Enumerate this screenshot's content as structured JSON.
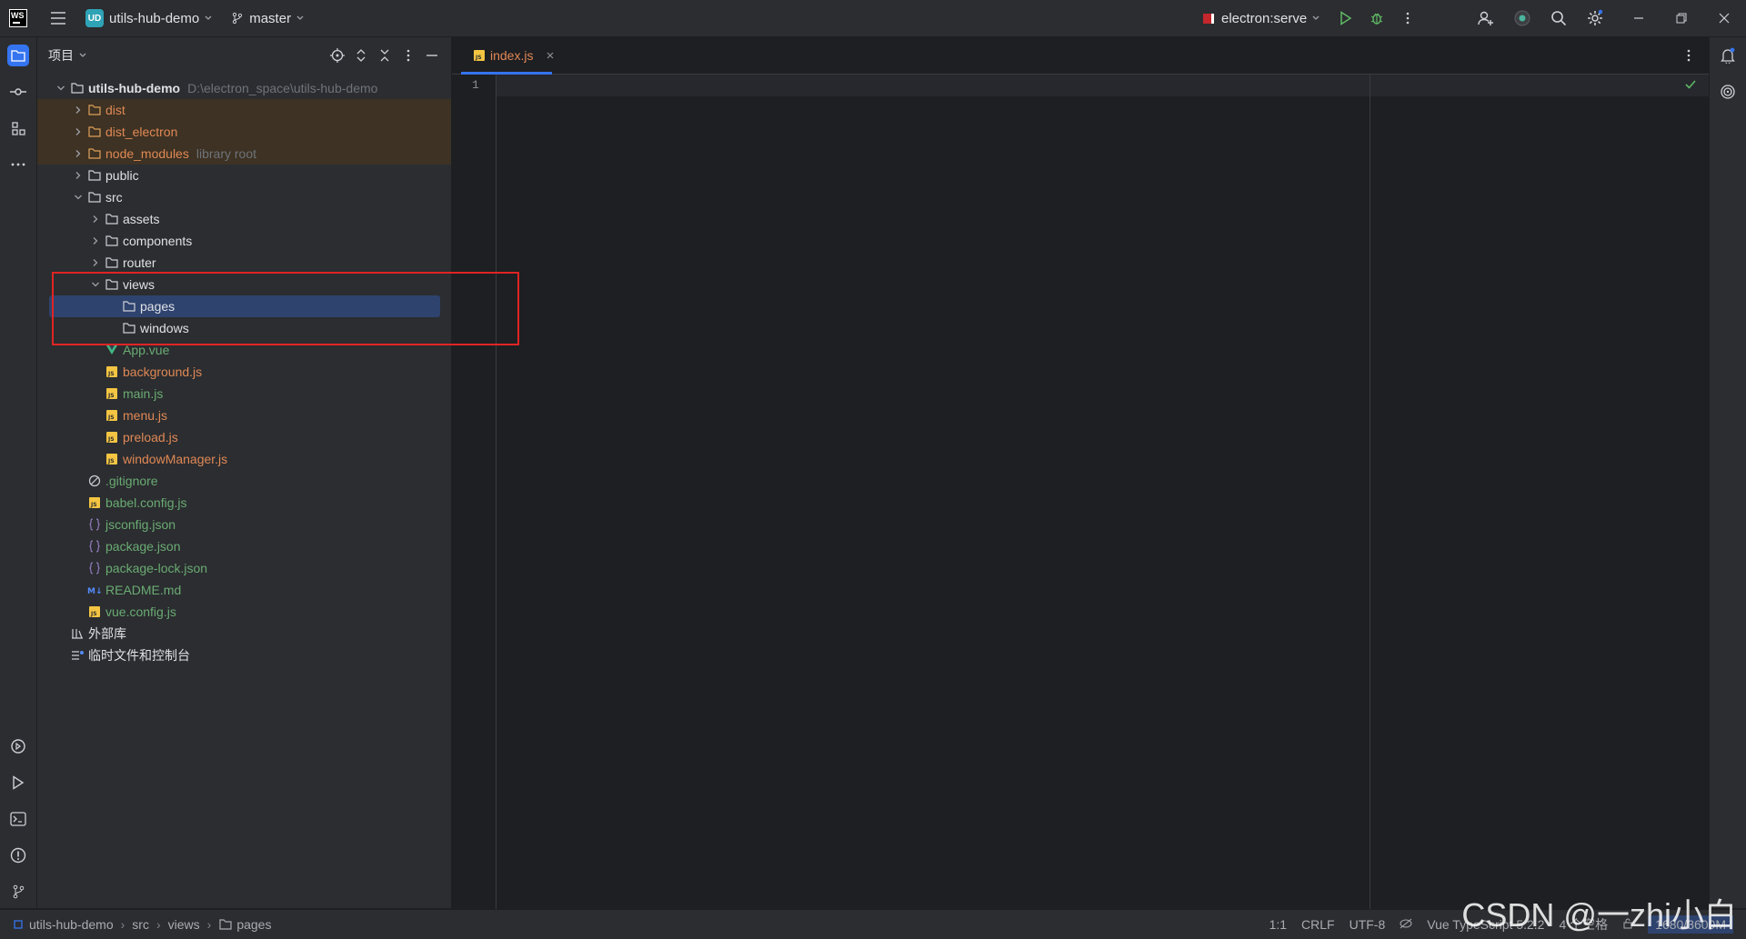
{
  "titlebar": {
    "project_badge": "UD",
    "project_name": "utils-hub-demo",
    "branch": "master",
    "run_config": "electron:serve"
  },
  "project_panel": {
    "title": "项目",
    "tree": [
      {
        "label": "utils-hub-demo",
        "hint": "D:\\electron_space\\utils-hub-demo",
        "depth": 0,
        "expanded": true,
        "kind": "folder-root"
      },
      {
        "label": "dist",
        "hint": "",
        "depth": 1,
        "expanded": false,
        "kind": "folder-excluded"
      },
      {
        "label": "dist_electron",
        "hint": "",
        "depth": 1,
        "expanded": false,
        "kind": "folder-excluded"
      },
      {
        "label": "node_modules",
        "hint": "library root",
        "depth": 1,
        "expanded": false,
        "kind": "folder-excluded"
      },
      {
        "label": "public",
        "hint": "",
        "depth": 1,
        "expanded": false,
        "kind": "folder"
      },
      {
        "label": "src",
        "hint": "",
        "depth": 1,
        "expanded": true,
        "kind": "folder"
      },
      {
        "label": "assets",
        "hint": "",
        "depth": 2,
        "expanded": false,
        "kind": "folder"
      },
      {
        "label": "components",
        "hint": "",
        "depth": 2,
        "expanded": false,
        "kind": "folder"
      },
      {
        "label": "router",
        "hint": "",
        "depth": 2,
        "expanded": false,
        "kind": "folder"
      },
      {
        "label": "views",
        "hint": "",
        "depth": 2,
        "expanded": true,
        "kind": "folder"
      },
      {
        "label": "pages",
        "hint": "",
        "depth": 3,
        "kind": "folder-selected"
      },
      {
        "label": "windows",
        "hint": "",
        "depth": 3,
        "kind": "folder"
      },
      {
        "label": "App.vue",
        "hint": "",
        "depth": 2,
        "kind": "vue"
      },
      {
        "label": "background.js",
        "hint": "",
        "depth": 2,
        "kind": "js"
      },
      {
        "label": "main.js",
        "hint": "",
        "depth": 2,
        "kind": "js"
      },
      {
        "label": "menu.js",
        "hint": "",
        "depth": 2,
        "kind": "js"
      },
      {
        "label": "preload.js",
        "hint": "",
        "depth": 2,
        "kind": "js"
      },
      {
        "label": "windowManager.js",
        "hint": "",
        "depth": 2,
        "kind": "js"
      },
      {
        "label": ".gitignore",
        "hint": "",
        "depth": 1,
        "kind": "ignore"
      },
      {
        "label": "babel.config.js",
        "hint": "",
        "depth": 1,
        "kind": "js"
      },
      {
        "label": "jsconfig.json",
        "hint": "",
        "depth": 1,
        "kind": "json"
      },
      {
        "label": "package.json",
        "hint": "",
        "depth": 1,
        "kind": "json"
      },
      {
        "label": "package-lock.json",
        "hint": "",
        "depth": 1,
        "kind": "json"
      },
      {
        "label": "README.md",
        "hint": "",
        "depth": 1,
        "kind": "md"
      },
      {
        "label": "vue.config.js",
        "hint": "",
        "depth": 1,
        "kind": "js"
      },
      {
        "label": "外部库",
        "hint": "",
        "depth": 0,
        "kind": "library"
      },
      {
        "label": "临时文件和控制台",
        "hint": "",
        "depth": 0,
        "kind": "scratch"
      }
    ]
  },
  "editor": {
    "tab_label": "index.js",
    "line_number": "1"
  },
  "statusbar": {
    "breadcrumbs": [
      "utils-hub-demo",
      "src",
      "views",
      "pages"
    ],
    "position": "1:1",
    "line_ending": "CRLF",
    "encoding": "UTF-8",
    "language": "Vue TypeScript 5.2.2",
    "indent": "4 个空格",
    "memory": "1680/3600M"
  },
  "watermark": "CSDN @一zhi小白",
  "colors": {
    "accent": "#3574f0",
    "selection": "#2e436e",
    "excluded_bg": "#3d3223",
    "annotation_box": "#e02424",
    "js_file": "#e08855",
    "vcs_added": "#6aab73"
  }
}
